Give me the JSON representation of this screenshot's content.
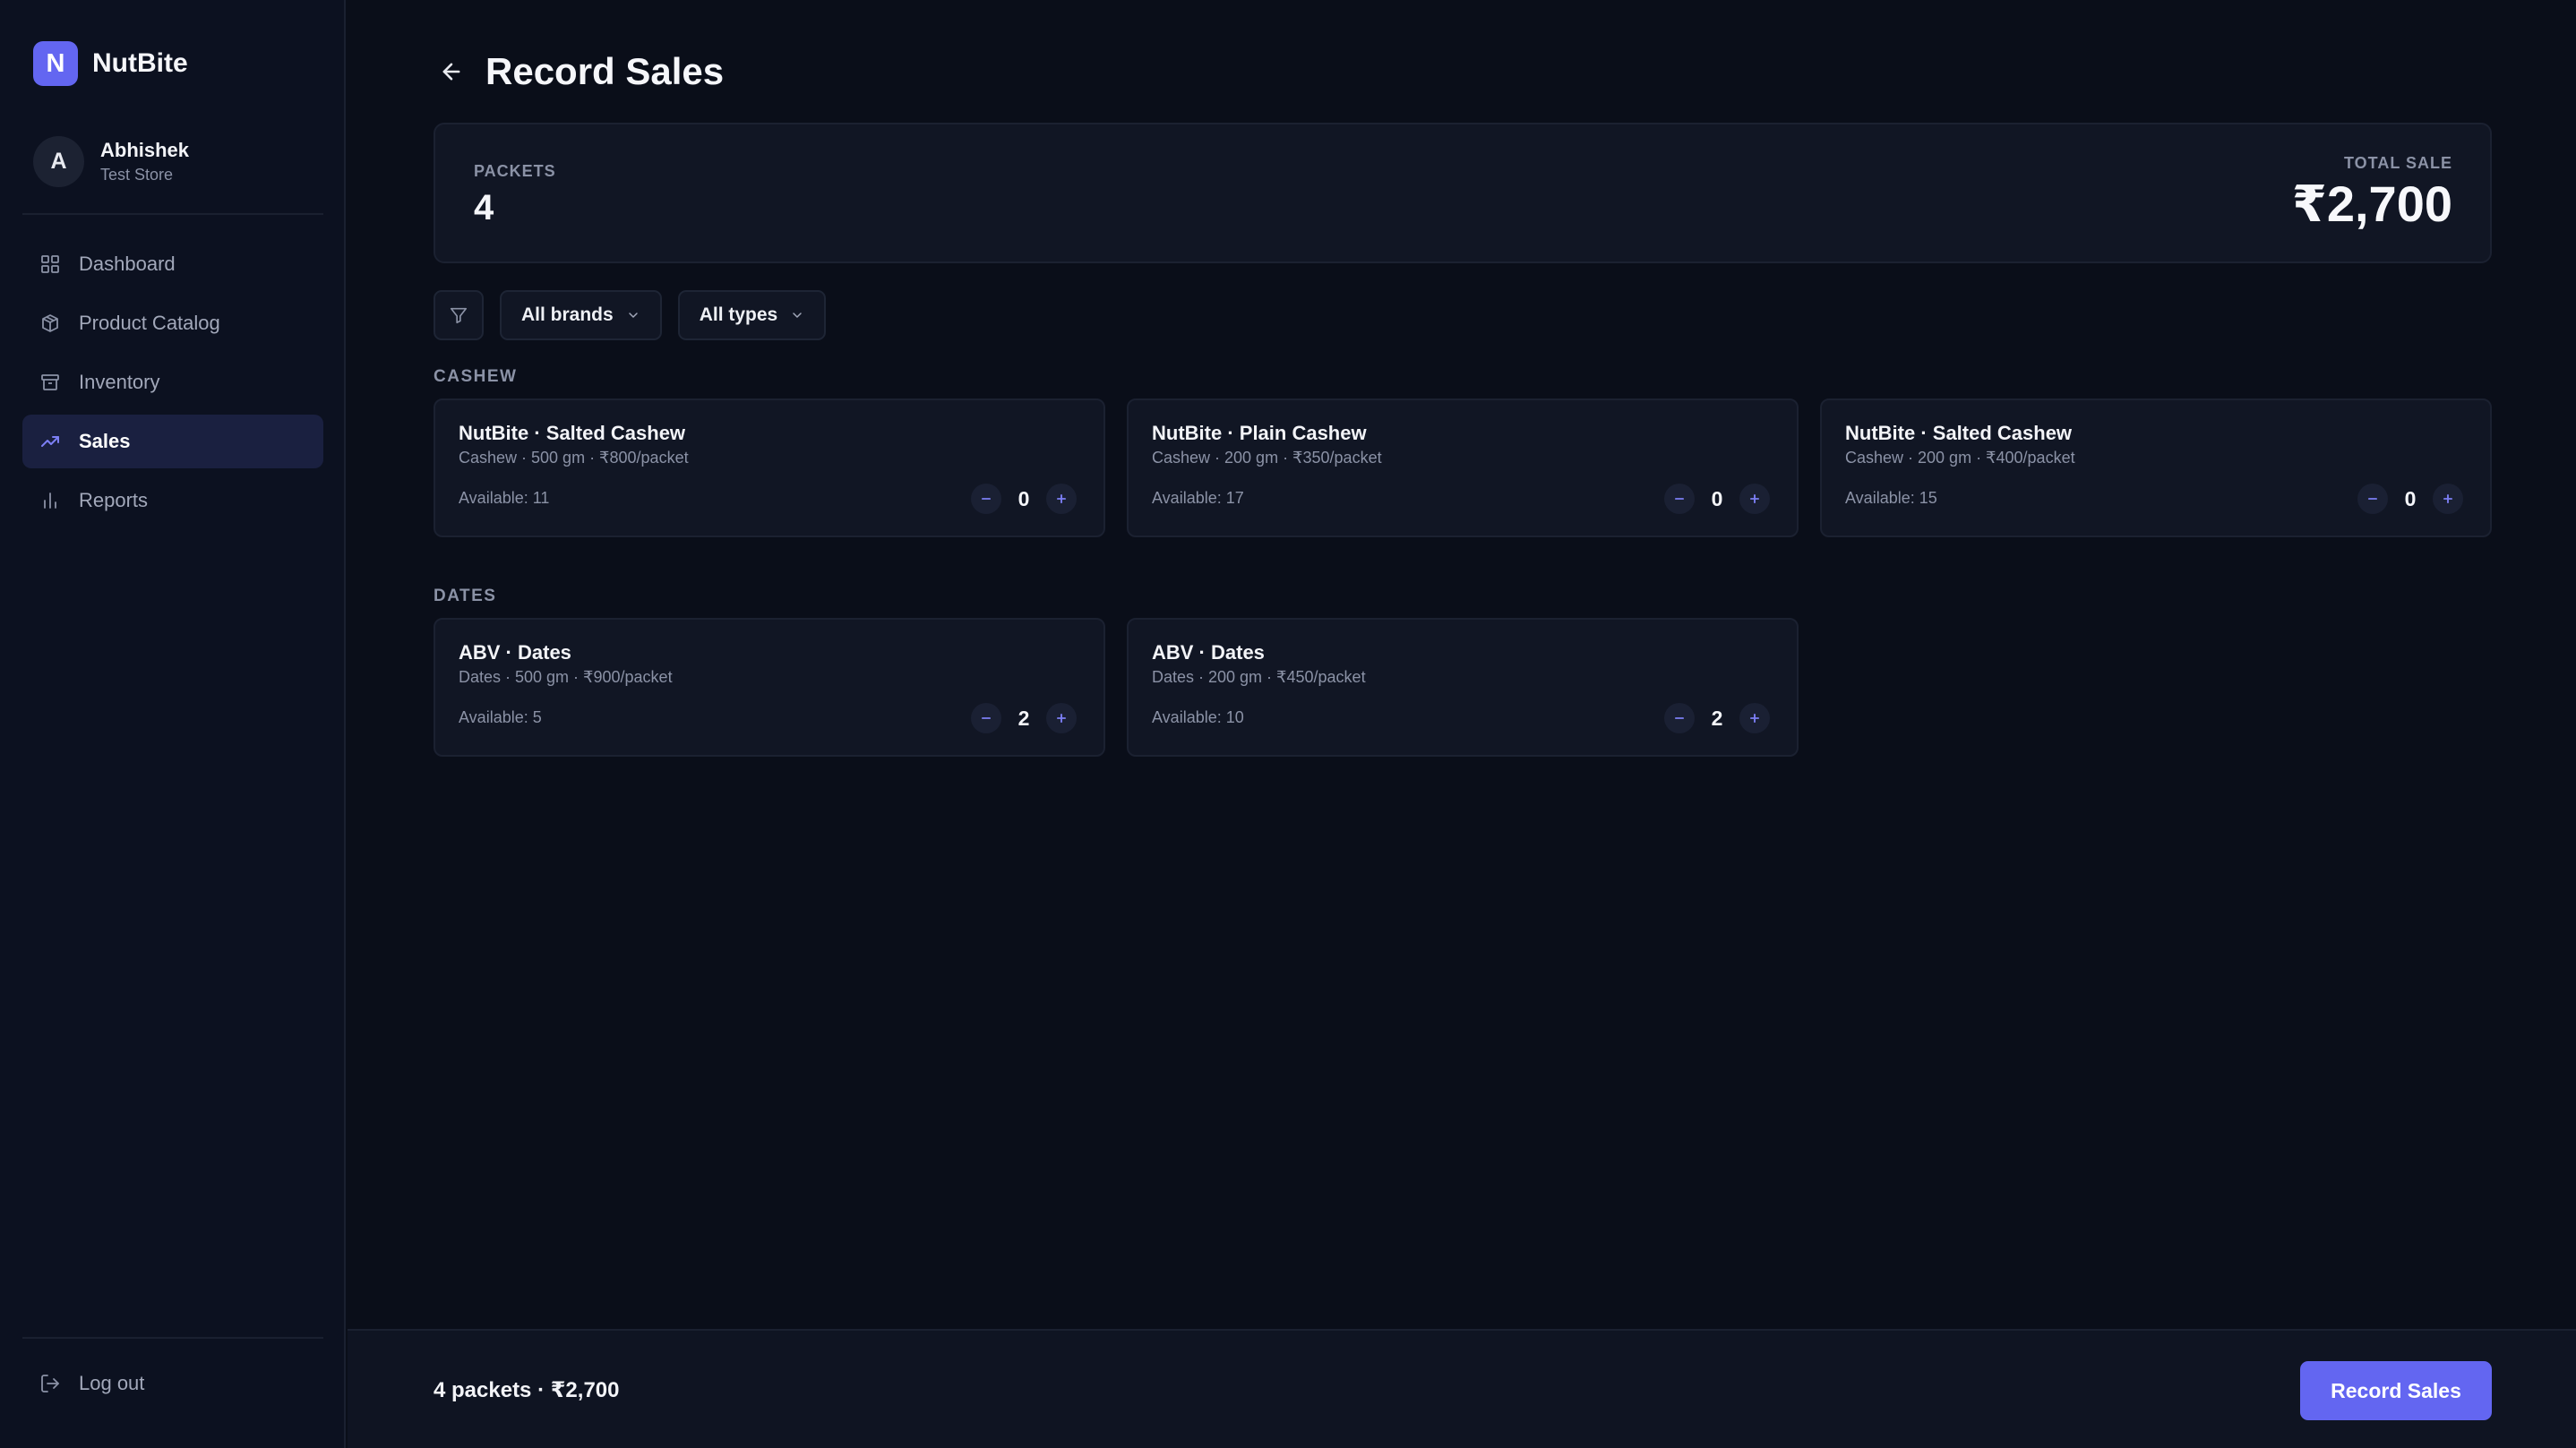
{
  "brand": {
    "initial": "N",
    "name": "NutBite"
  },
  "user": {
    "initial": "A",
    "name": "Abhishek",
    "store": "Test Store"
  },
  "nav": [
    {
      "label": "Dashboard",
      "icon": "grid-icon"
    },
    {
      "label": "Product Catalog",
      "icon": "box-icon"
    },
    {
      "label": "Inventory",
      "icon": "archive-icon"
    },
    {
      "label": "Sales",
      "icon": "trending-up-icon",
      "active": true
    },
    {
      "label": "Reports",
      "icon": "bar-chart-icon"
    }
  ],
  "logout_label": "Log out",
  "page_title": "Record Sales",
  "summary": {
    "packets_label": "PACKETS",
    "packets_value": "4",
    "total_label": "TOTAL SALE",
    "total_value": "₹2,700"
  },
  "filters": {
    "brands": "All brands",
    "types": "All types"
  },
  "sections": [
    {
      "title": "CASHEW",
      "items": [
        {
          "title": "NutBite · Salted Cashew",
          "sub": "Cashew · 500 gm · ₹800/packet",
          "available": "Available: 11",
          "qty": "0"
        },
        {
          "title": "NutBite · Plain Cashew",
          "sub": "Cashew · 200 gm · ₹350/packet",
          "available": "Available: 17",
          "qty": "0"
        },
        {
          "title": "NutBite · Salted Cashew",
          "sub": "Cashew · 200 gm · ₹400/packet",
          "available": "Available: 15",
          "qty": "0"
        }
      ]
    },
    {
      "title": "DATES",
      "items": [
        {
          "title": "ABV · Dates",
          "sub": "Dates · 500 gm · ₹900/packet",
          "available": "Available: 5",
          "qty": "2"
        },
        {
          "title": "ABV · Dates",
          "sub": "Dates · 200 gm · ₹450/packet",
          "available": "Available: 10",
          "qty": "2"
        }
      ]
    }
  ],
  "footer": {
    "summary": "4 packets · ₹2,700",
    "button": "Record Sales"
  },
  "colors": {
    "accent": "#6366f1",
    "background": "#0a0e19",
    "card": "#111624"
  }
}
